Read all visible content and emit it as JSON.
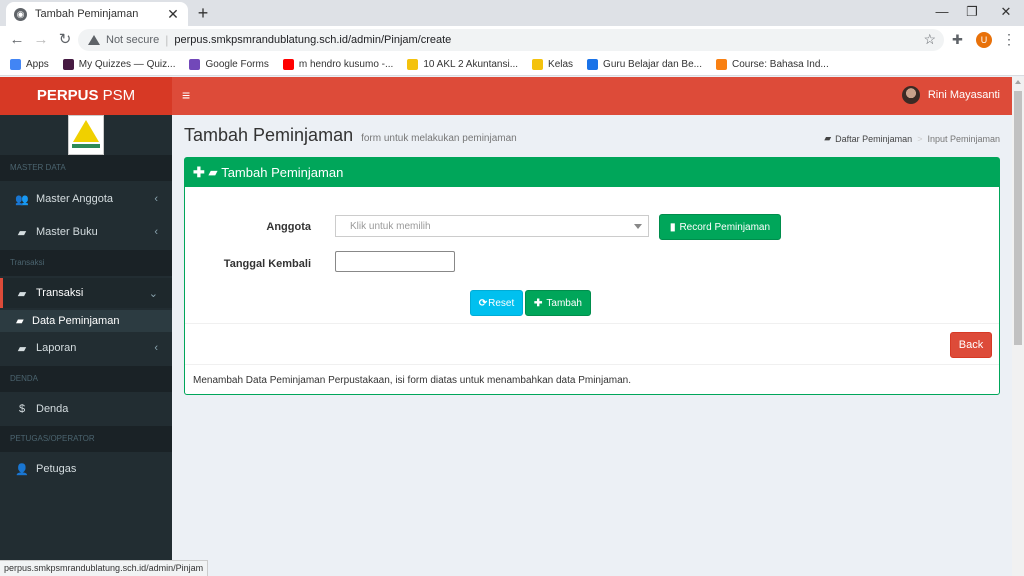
{
  "browser": {
    "tab_title": "Tambah Peminjaman",
    "tab_close": "✕",
    "new_tab": "+",
    "not_secure": "Not secure",
    "url": "perpus.smkpsmrandublatung.sch.id/admin/Pinjam/create",
    "profile_initial": "U",
    "bookmarks": [
      {
        "label": "Apps",
        "color": "#4285f4"
      },
      {
        "label": "My Quizzes — Quiz...",
        "color": "#461a42"
      },
      {
        "label": "Google Forms",
        "color": "#7248b9"
      },
      {
        "label": "m hendro kusumo -...",
        "color": "#ff0000"
      },
      {
        "label": "10 AKL 2 Akuntansi...",
        "color": "#f4c20d"
      },
      {
        "label": "Kelas",
        "color": "#f4c20d"
      },
      {
        "label": "Guru Belajar dan Be...",
        "color": "#1a73e8"
      },
      {
        "label": "Course: Bahasa Ind...",
        "color": "#f98012"
      }
    ],
    "status_url": "perpus.smkpsmrandublatung.sch.id/admin/Pinjam"
  },
  "header": {
    "logo_bold": "PERPUS",
    "logo_rest": " PSM",
    "user_name": "Rini Mayasanti",
    "brand_color": "#dd4b39"
  },
  "sidebar": {
    "sections": {
      "master_data": "MASTER DATA",
      "transaksi": "Transaksi",
      "denda": "DENDA",
      "petugas": "PETUGAS/OPERATOR"
    },
    "items": {
      "master_anggota": "Master Anggota",
      "master_buku": "Master Buku",
      "transaksi": "Transaksi",
      "data_peminjaman": "Data Peminjaman",
      "laporan": "Laporan",
      "denda": "Denda",
      "petugas": "Petugas"
    }
  },
  "page": {
    "title": "Tambah Peminjaman",
    "subtitle": "form untuk melakukan peminjaman",
    "breadcrumb": {
      "parent": "Daftar Peminjaman",
      "current": "Input Peminjaman"
    }
  },
  "form": {
    "box_title": "Tambah Peminjaman",
    "anggota_label": "Anggota",
    "anggota_placeholder": "Klik untuk memilih",
    "record_button": "Record Peminjaman",
    "tanggal_label": "Tanggal Kembali",
    "tanggal_value": "",
    "reset_button": "Reset",
    "tambah_button": "Tambah",
    "back_button": "Back",
    "footer_note": "Menambah Data Peminjaman Perpustakaan, isi form diatas untuk menambahkan data Pminjaman.",
    "accent_color": "#00a65a"
  }
}
